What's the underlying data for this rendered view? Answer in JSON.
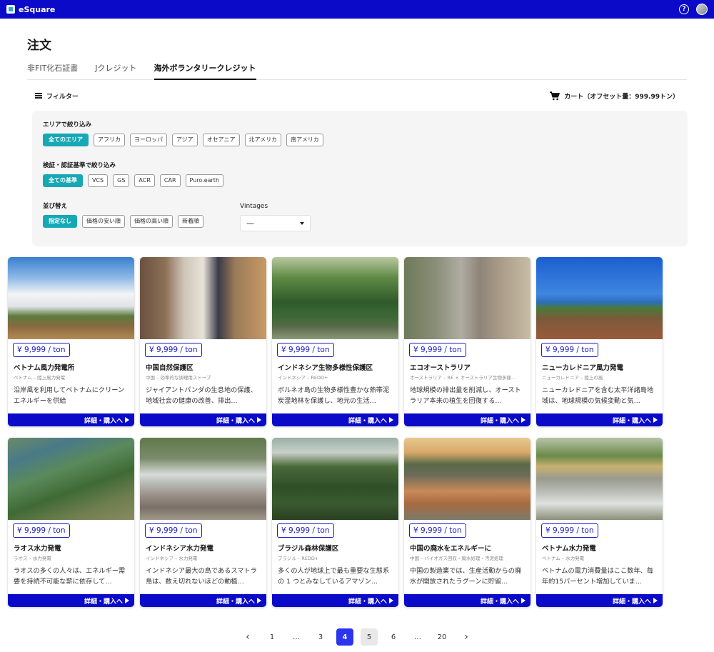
{
  "app": {
    "brand": "eSquare"
  },
  "page": {
    "title": "注文"
  },
  "tabs": [
    {
      "label": "非FIT化石証書"
    },
    {
      "label": "Jクレジット"
    },
    {
      "label": "海外ボランタリークレジット"
    }
  ],
  "toolbar": {
    "filter_label": "フィルター",
    "cart_label": "カート（オフセット量：999.99トン）"
  },
  "filters": {
    "area_label": "エリアで絞り込み",
    "areas": [
      "全てのエリア",
      "アフリカ",
      "ヨーロッパ",
      "アジア",
      "オセアニア",
      "北アメリカ",
      "南アメリカ"
    ],
    "standard_label": "検証・認証基準で絞り込み",
    "standards": [
      "全ての基準",
      "VCS",
      "GS",
      "ACR",
      "CAR",
      "Puro.earth"
    ],
    "sort_label": "並び替え",
    "sorts": [
      "指定なし",
      "価格の安い順",
      "価格の高い順",
      "新着順"
    ],
    "vintages_label": "Vintages",
    "vintages_value": "—"
  },
  "cards": [
    {
      "price": "¥ 9,999 / ton",
      "title": "ベトナム風力発電所",
      "sub": "ベトナム – 陸上風力発電",
      "desc": "沿岸風を利用してベトナムにクリーンエネルギーを供給",
      "button": "詳細・購入へ"
    },
    {
      "price": "¥ 9,999 / ton",
      "title": "中国自然保護区",
      "sub": "中国 – 効率的な調理用ストーブ",
      "desc": "ジャイアントパンダの生息地の保護、地域社会の健康の改善、排出…",
      "button": "詳細・購入へ"
    },
    {
      "price": "¥ 9,999 / ton",
      "title": "インドネシア生物多様性保護区",
      "sub": "インドネシア – REDD+",
      "desc": "ボルネオ島の生物多様性豊かな熱帯泥炭湿地林を保護し、地元の生活…",
      "button": "詳細・購入へ"
    },
    {
      "price": "¥ 9,999 / ton",
      "title": "エコオーストラリア",
      "sub": "オーストラリア – RE + オーストラリア生物多様…",
      "desc": "地球規模の排出量を削減し、オーストラリア本来の植生を回復する…",
      "button": "詳細・購入へ"
    },
    {
      "price": "¥ 9,999 / ton",
      "title": "ニューカレドニア風力発電",
      "sub": "ニューカレドニア – 陸上の風",
      "desc": "ニューカレドニアを含む太平洋諸島地域は、地球規模の気候変動と気…",
      "button": "詳細・購入へ"
    },
    {
      "price": "¥ 9,999 / ton",
      "title": "ラオス水力発電",
      "sub": "ラオス – 水力発電",
      "desc": "ラオスの多くの人々は、エネルギー需要を持続不可能な薪に依存して…",
      "button": "詳細・購入へ"
    },
    {
      "price": "¥ 9,999 / ton",
      "title": "インドネシア水力発電",
      "sub": "インドネシア – 水力発電",
      "desc": "インドネシア最大の島であるスマトラ島は、数え切れないほどの動植…",
      "button": "詳細・購入へ"
    },
    {
      "price": "¥ 9,999 / ton",
      "title": "ブラジル森林保護区",
      "sub": "ブラジル – REDD+",
      "desc": "多くの人が地球上で最も重要な生態系の 1 つとみなしているアマゾン…",
      "button": "詳細・購入へ"
    },
    {
      "price": "¥ 9,999 / ton",
      "title": "中国の廃水をエネルギーに",
      "sub": "中国 – バイオガス回収・廃水処理・汚泥処理",
      "desc": "中国の製造業では、生産活動からの廃水が開放されたラグーンに貯留…",
      "button": "詳細・購入へ"
    },
    {
      "price": "¥ 9,999 / ton",
      "title": "ベトナム水力発電",
      "sub": "ベトナム – 水力発電",
      "desc": "ベトナムの電力消費量はここ数年、毎年約15パーセント増加していま…",
      "button": "詳細・購入へ"
    }
  ],
  "pagination": {
    "pages": [
      "1",
      "…",
      "3",
      "4",
      "5",
      "6",
      "…",
      "20"
    ],
    "current": "4"
  },
  "colors": {
    "brand": "#0a0ac8",
    "accent": "#17a8b6",
    "active_page": "#2b35ee"
  }
}
